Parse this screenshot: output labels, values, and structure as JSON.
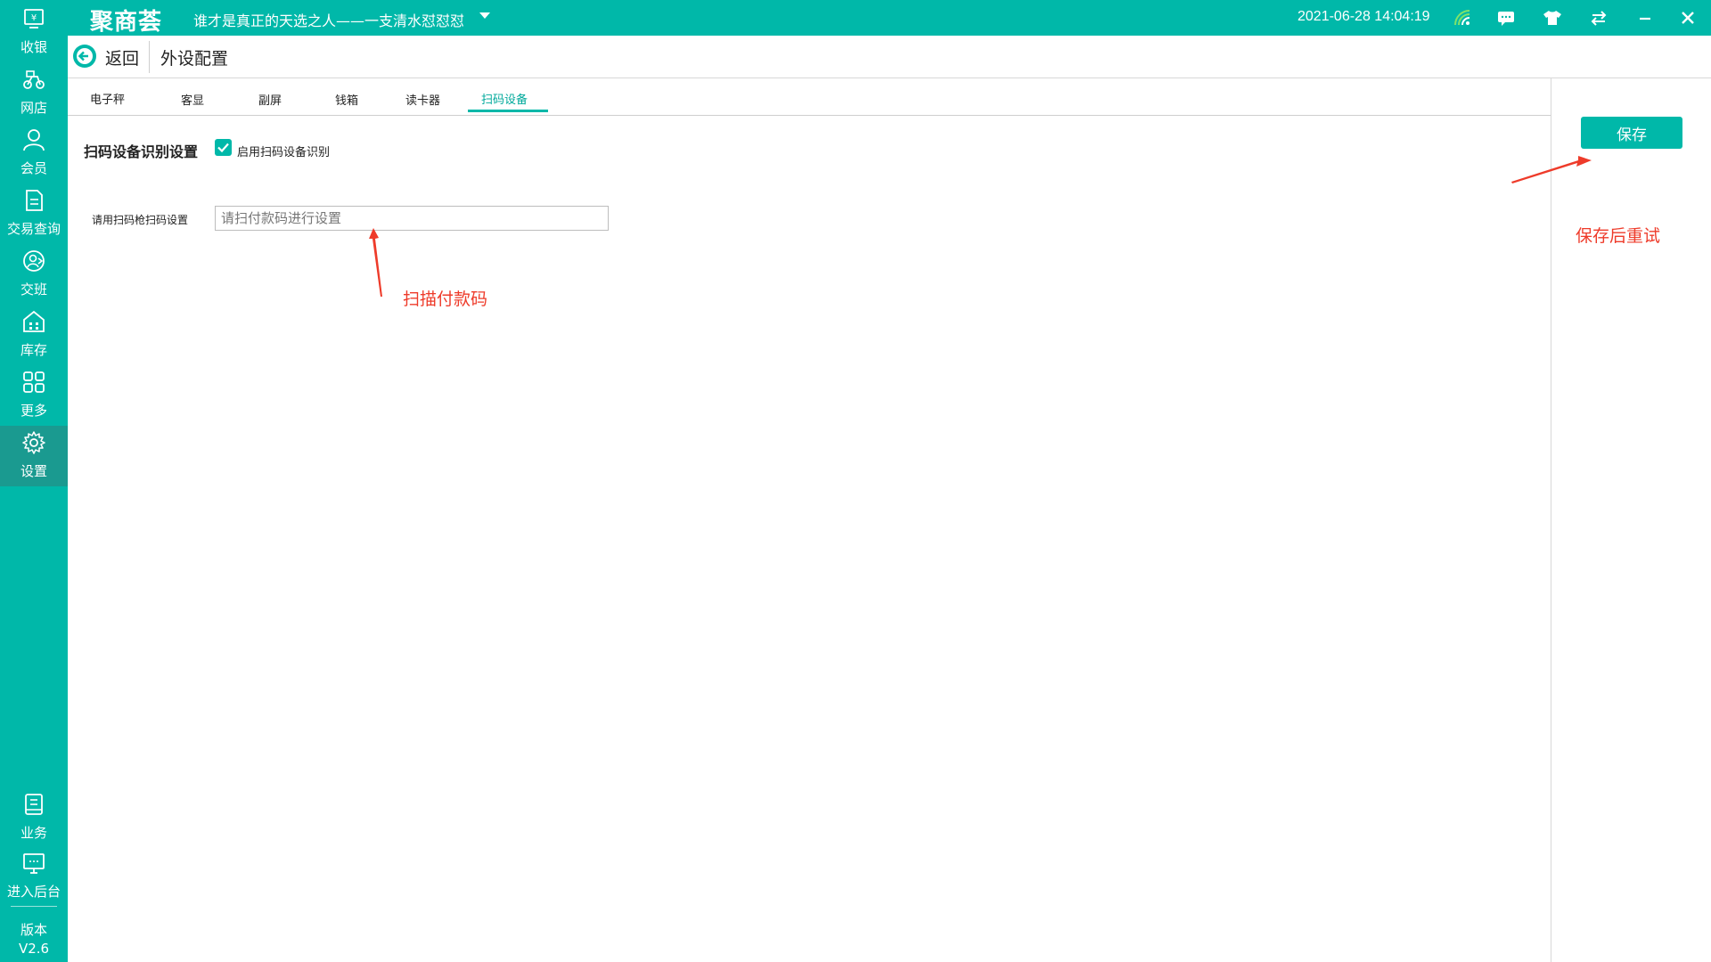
{
  "app": {
    "logo": "聚商荟",
    "store_name": "谁才是真正的天选之人——一支清水怼怼怼",
    "datetime": "2021-06-28 14:04:19"
  },
  "sidebar": {
    "items": [
      {
        "label": "收银",
        "icon": "cashier-icon"
      },
      {
        "label": "网店",
        "icon": "bike-icon"
      },
      {
        "label": "会员",
        "icon": "user-icon"
      },
      {
        "label": "交易查询",
        "icon": "document-icon"
      },
      {
        "label": "交班",
        "icon": "shift-icon"
      },
      {
        "label": "库存",
        "icon": "warehouse-icon"
      },
      {
        "label": "更多",
        "icon": "grid-icon"
      },
      {
        "label": "设置",
        "icon": "gear-icon"
      }
    ],
    "bottom_items": [
      {
        "label": "业务",
        "icon": "book-icon"
      },
      {
        "label": "进入后台",
        "icon": "monitor-icon"
      }
    ],
    "version_label": "版本",
    "version": "V2.6"
  },
  "header": {
    "back_label": "返回",
    "title": "外设配置"
  },
  "tabs": [
    "电子秤",
    "客显",
    "副屏",
    "钱箱",
    "读卡器",
    "扫码设备"
  ],
  "active_tab": "扫码设备",
  "scanner": {
    "section_title": "扫码设备识别设置",
    "enable_label": "启用扫码设备识别",
    "enabled": true,
    "field_label": "请用扫码枪扫码设置",
    "placeholder": "请扫付款码进行设置",
    "value": ""
  },
  "save_label": "保存",
  "annotations": {
    "scan_hint": "扫描付款码",
    "save_hint": "保存后重试"
  },
  "colors": {
    "accent": "#00b8a9",
    "annotation": "#ee3b2a"
  }
}
